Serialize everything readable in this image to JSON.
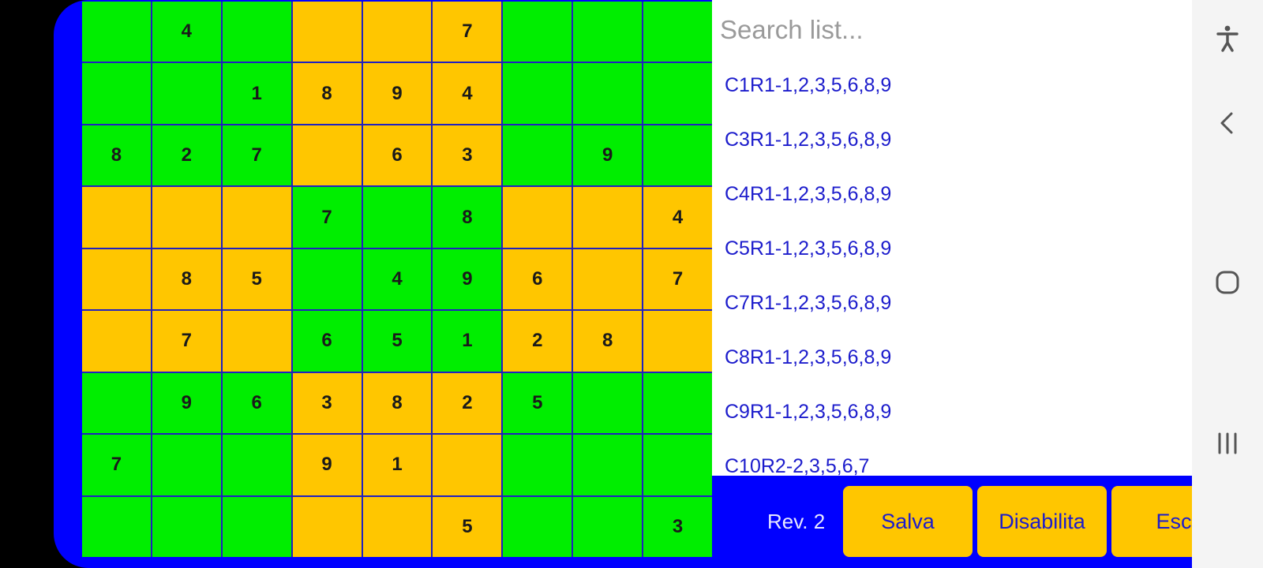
{
  "colors": {
    "frame": "#0000ff",
    "cell_green": "#00ee00",
    "cell_yellow": "#ffc600",
    "list_text": "#1c1ccc"
  },
  "grid": {
    "rows": [
      [
        {
          "v": "",
          "c": "g"
        },
        {
          "v": "4",
          "c": "g"
        },
        {
          "v": "",
          "c": "g"
        },
        {
          "v": "",
          "c": "y"
        },
        {
          "v": "",
          "c": "y"
        },
        {
          "v": "7",
          "c": "y"
        },
        {
          "v": "",
          "c": "g"
        },
        {
          "v": "",
          "c": "g"
        },
        {
          "v": "",
          "c": "g"
        }
      ],
      [
        {
          "v": "",
          "c": "g"
        },
        {
          "v": "",
          "c": "g"
        },
        {
          "v": "1",
          "c": "g"
        },
        {
          "v": "8",
          "c": "y"
        },
        {
          "v": "9",
          "c": "y"
        },
        {
          "v": "4",
          "c": "y"
        },
        {
          "v": "",
          "c": "g"
        },
        {
          "v": "",
          "c": "g"
        },
        {
          "v": "",
          "c": "g"
        }
      ],
      [
        {
          "v": "8",
          "c": "g"
        },
        {
          "v": "2",
          "c": "g"
        },
        {
          "v": "7",
          "c": "g"
        },
        {
          "v": "",
          "c": "y"
        },
        {
          "v": "6",
          "c": "y"
        },
        {
          "v": "3",
          "c": "y"
        },
        {
          "v": "",
          "c": "g"
        },
        {
          "v": "9",
          "c": "g"
        },
        {
          "v": "",
          "c": "g"
        }
      ],
      [
        {
          "v": "",
          "c": "y"
        },
        {
          "v": "",
          "c": "y"
        },
        {
          "v": "",
          "c": "y"
        },
        {
          "v": "7",
          "c": "g"
        },
        {
          "v": "",
          "c": "g"
        },
        {
          "v": "8",
          "c": "g"
        },
        {
          "v": "",
          "c": "y"
        },
        {
          "v": "",
          "c": "y"
        },
        {
          "v": "4",
          "c": "y"
        }
      ],
      [
        {
          "v": "",
          "c": "y"
        },
        {
          "v": "8",
          "c": "y"
        },
        {
          "v": "5",
          "c": "y"
        },
        {
          "v": "",
          "c": "g"
        },
        {
          "v": "4",
          "c": "g"
        },
        {
          "v": "9",
          "c": "g"
        },
        {
          "v": "6",
          "c": "y"
        },
        {
          "v": "",
          "c": "y"
        },
        {
          "v": "7",
          "c": "y"
        }
      ],
      [
        {
          "v": "",
          "c": "y"
        },
        {
          "v": "7",
          "c": "y"
        },
        {
          "v": "",
          "c": "y"
        },
        {
          "v": "6",
          "c": "g"
        },
        {
          "v": "5",
          "c": "g"
        },
        {
          "v": "1",
          "c": "g"
        },
        {
          "v": "2",
          "c": "y"
        },
        {
          "v": "8",
          "c": "y"
        },
        {
          "v": "",
          "c": "y"
        }
      ],
      [
        {
          "v": "",
          "c": "g"
        },
        {
          "v": "9",
          "c": "g"
        },
        {
          "v": "6",
          "c": "g"
        },
        {
          "v": "3",
          "c": "y"
        },
        {
          "v": "8",
          "c": "y"
        },
        {
          "v": "2",
          "c": "y"
        },
        {
          "v": "5",
          "c": "g"
        },
        {
          "v": "",
          "c": "g"
        },
        {
          "v": "",
          "c": "g"
        }
      ],
      [
        {
          "v": "7",
          "c": "g"
        },
        {
          "v": "",
          "c": "g"
        },
        {
          "v": "",
          "c": "g"
        },
        {
          "v": "9",
          "c": "y"
        },
        {
          "v": "1",
          "c": "y"
        },
        {
          "v": "",
          "c": "y"
        },
        {
          "v": "",
          "c": "g"
        },
        {
          "v": "",
          "c": "g"
        },
        {
          "v": "",
          "c": "g"
        }
      ],
      [
        {
          "v": "",
          "c": "g"
        },
        {
          "v": "",
          "c": "g"
        },
        {
          "v": "",
          "c": "g"
        },
        {
          "v": "",
          "c": "y"
        },
        {
          "v": "",
          "c": "y"
        },
        {
          "v": "5",
          "c": "y"
        },
        {
          "v": "",
          "c": "g"
        },
        {
          "v": "",
          "c": "g"
        },
        {
          "v": "3",
          "c": "g"
        }
      ]
    ]
  },
  "search": {
    "placeholder": "Search list...",
    "value": ""
  },
  "list": {
    "items": [
      "C1R1-1,2,3,5,6,8,9",
      "C3R1-1,2,3,5,6,8,9",
      "C4R1-1,2,3,5,6,8,9",
      "C5R1-1,2,3,5,6,8,9",
      "C7R1-1,2,3,5,6,8,9",
      "C8R1-1,2,3,5,6,8,9",
      "C9R1-1,2,3,5,6,8,9",
      "C10R2-2,3,5,6,7"
    ]
  },
  "footer": {
    "rev_label": "Rev. 2",
    "salva_label": "Salva",
    "disabilita_label": "Disabilita",
    "esci_label": "Esci"
  },
  "nav": {
    "icons": [
      "accessibility-icon",
      "back-icon",
      "home-icon",
      "recents-icon"
    ]
  }
}
